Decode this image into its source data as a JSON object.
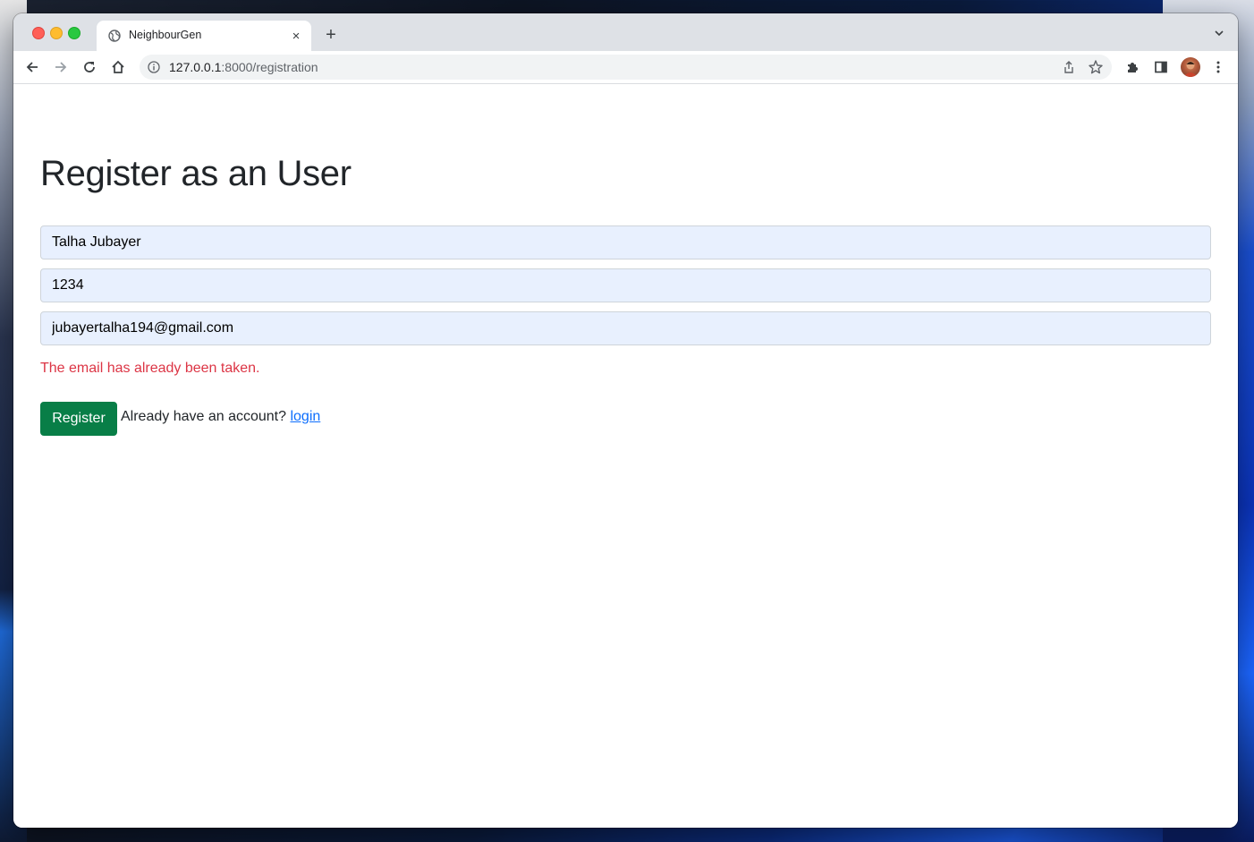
{
  "browser": {
    "tab_title": "NeighbourGen",
    "close_glyph": "×",
    "new_tab_glyph": "+",
    "url_host": "127.0.0.1",
    "url_path": ":8000/registration"
  },
  "icons": {
    "favicon": "globe-icon",
    "back": "back-arrow-icon",
    "forward": "forward-arrow-icon",
    "reload": "reload-icon",
    "home": "home-icon",
    "site_info": "info-icon",
    "share": "share-icon",
    "bookmark": "star-icon",
    "extensions": "puzzle-icon",
    "side_panel": "side-panel-icon",
    "menu": "kebab-menu-icon"
  },
  "form": {
    "title": "Register as an User",
    "name_value": "Talha Jubayer",
    "password_value": "1234",
    "email_value": "jubayertalha194@gmail.com",
    "email_error": "The email has already been taken.",
    "register_label": "Register",
    "login_prompt": "Already have an account?",
    "login_link": "login"
  },
  "colors": {
    "button_green": "#087e47",
    "error_red": "#dc3545",
    "link_blue": "#0d6efd",
    "autofill_bg": "#e8f0fe"
  }
}
